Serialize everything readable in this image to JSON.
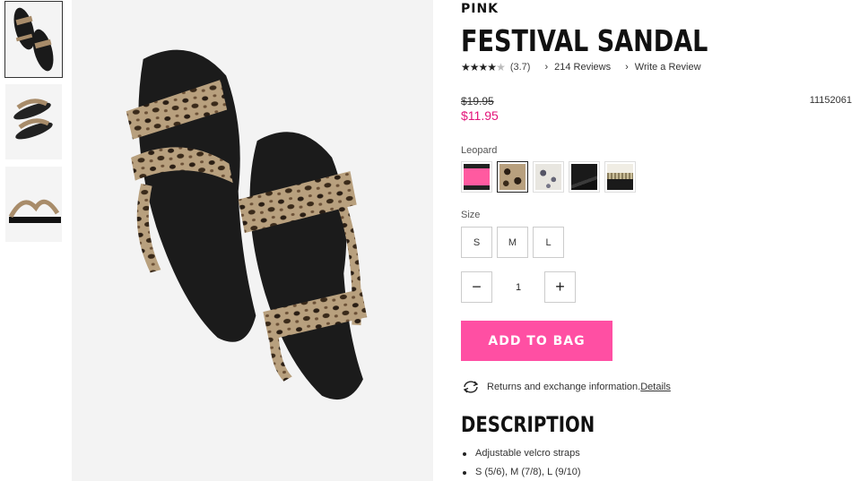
{
  "product": {
    "brand": "PINK",
    "title": "FESTIVAL SANDAL",
    "rating": 3.7,
    "rating_text": "(3.7)",
    "reviews_link": "214 Reviews",
    "write_review_link": "Write a Review",
    "old_price": "$19.95",
    "sale_price": "$11.95",
    "sku": "11152061"
  },
  "color": {
    "label": "Leopard",
    "swatches": [
      {
        "name": "pink",
        "selected": false
      },
      {
        "name": "leopard",
        "selected": true
      },
      {
        "name": "snake",
        "selected": false
      },
      {
        "name": "black",
        "selected": false
      },
      {
        "name": "stripe",
        "selected": false
      }
    ]
  },
  "size": {
    "label": "Size",
    "options": [
      "S",
      "M",
      "L"
    ]
  },
  "quantity": {
    "minus": "−",
    "value": "1",
    "plus": "+"
  },
  "cta": {
    "add_to_bag": "ADD TO BAG"
  },
  "returns": {
    "text": "Returns and exchange information.",
    "details_link": "Details"
  },
  "description": {
    "title": "DESCRIPTION",
    "items": [
      "Adjustable velcro straps",
      "S (5/6), M (7/8), L (9/10)"
    ]
  },
  "colors": {
    "accent_pink": "#ff4fa3",
    "sale_pink": "#e3147a",
    "text_dark": "#111111"
  },
  "icons": {
    "chevron": "chevron-right-icon",
    "returns": "exchange-arrows-icon",
    "star": "star-icon"
  }
}
